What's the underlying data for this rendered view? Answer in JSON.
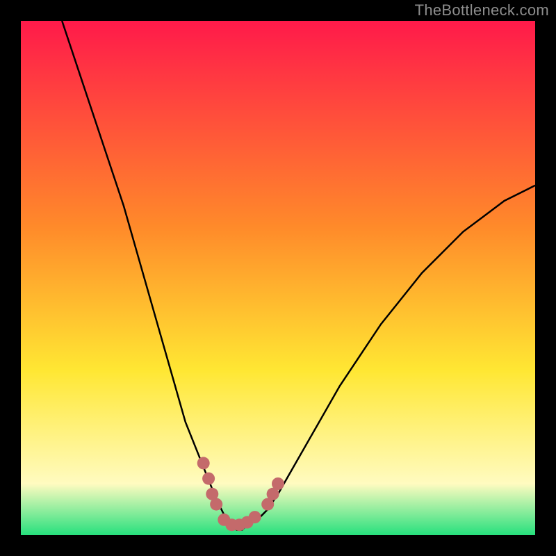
{
  "watermark": "TheBottleneck.com",
  "colors": {
    "bg": "#000000",
    "grad_top": "#ff1a4a",
    "grad_mid_orange": "#ff8a2a",
    "grad_mid_yellow": "#ffe733",
    "grad_pale": "#fffbc0",
    "grad_green": "#26e07d",
    "curve_stroke": "#000000",
    "marker_fill": "#c46a6b"
  },
  "chart_data": {
    "type": "line",
    "title": "",
    "xlabel": "",
    "ylabel": "",
    "xlim": [
      0,
      100
    ],
    "ylim": [
      0,
      100
    ],
    "series": [
      {
        "name": "bottleneck-curve",
        "x": [
          8,
          10,
          12,
          14,
          16,
          18,
          20,
          22,
          24,
          26,
          28,
          30,
          32,
          34,
          36,
          38,
          39,
          40,
          41,
          42,
          43,
          44,
          46,
          48,
          50,
          54,
          58,
          62,
          66,
          70,
          74,
          78,
          82,
          86,
          90,
          94,
          98,
          100
        ],
        "y": [
          100,
          94,
          88,
          82,
          76,
          70,
          64,
          57,
          50,
          43,
          36,
          29,
          22,
          17,
          12,
          7,
          5,
          3,
          2,
          1,
          1,
          2,
          3,
          5,
          8,
          15,
          22,
          29,
          35,
          41,
          46,
          51,
          55,
          59,
          62,
          65,
          67,
          68
        ]
      }
    ],
    "markers": {
      "name": "highlight-dots",
      "points": [
        {
          "x": 35.5,
          "y": 14
        },
        {
          "x": 36.5,
          "y": 11
        },
        {
          "x": 37.2,
          "y": 8
        },
        {
          "x": 38.0,
          "y": 6
        },
        {
          "x": 39.5,
          "y": 3
        },
        {
          "x": 41.0,
          "y": 2
        },
        {
          "x": 42.5,
          "y": 2
        },
        {
          "x": 44.0,
          "y": 2.5
        },
        {
          "x": 45.5,
          "y": 3.5
        },
        {
          "x": 48.0,
          "y": 6
        },
        {
          "x": 49.0,
          "y": 8
        },
        {
          "x": 50.0,
          "y": 10
        }
      ]
    }
  }
}
